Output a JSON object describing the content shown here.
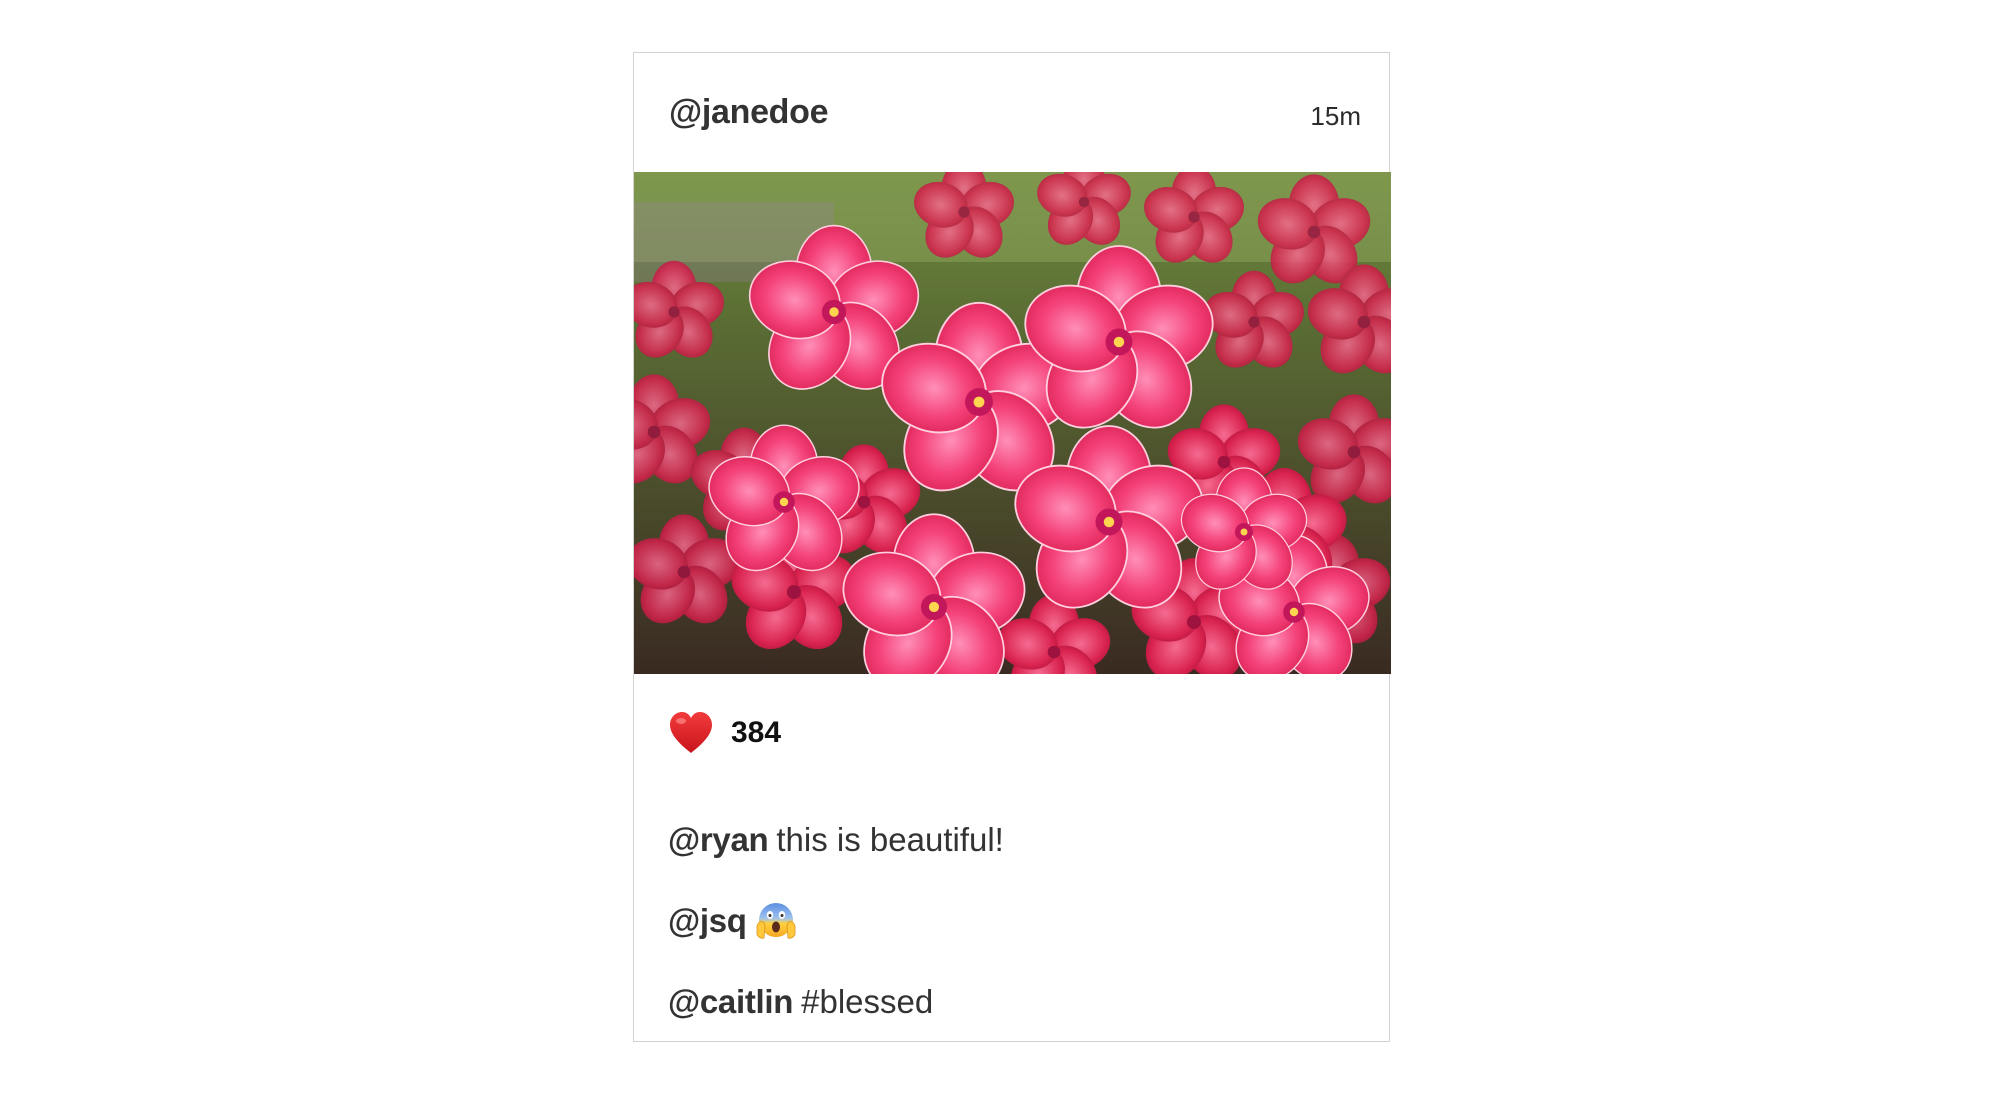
{
  "post": {
    "author": "@janedoe",
    "timestamp": "15m",
    "photo_icon": "pink-phlox-flowers-photo",
    "likes": {
      "icon": "heart-icon",
      "count": "384"
    },
    "comments": [
      {
        "user": "@ryan",
        "text": "this is beautiful!"
      },
      {
        "user": "@jsq",
        "icon": "screaming-face-emoji-icon"
      },
      {
        "user": "@caitlin",
        "text": "#blessed"
      }
    ]
  },
  "colors": {
    "card_border": "#d2d2d2",
    "heart": "#e0242b",
    "flower_pink": "#f0396a",
    "text": "#333333"
  }
}
